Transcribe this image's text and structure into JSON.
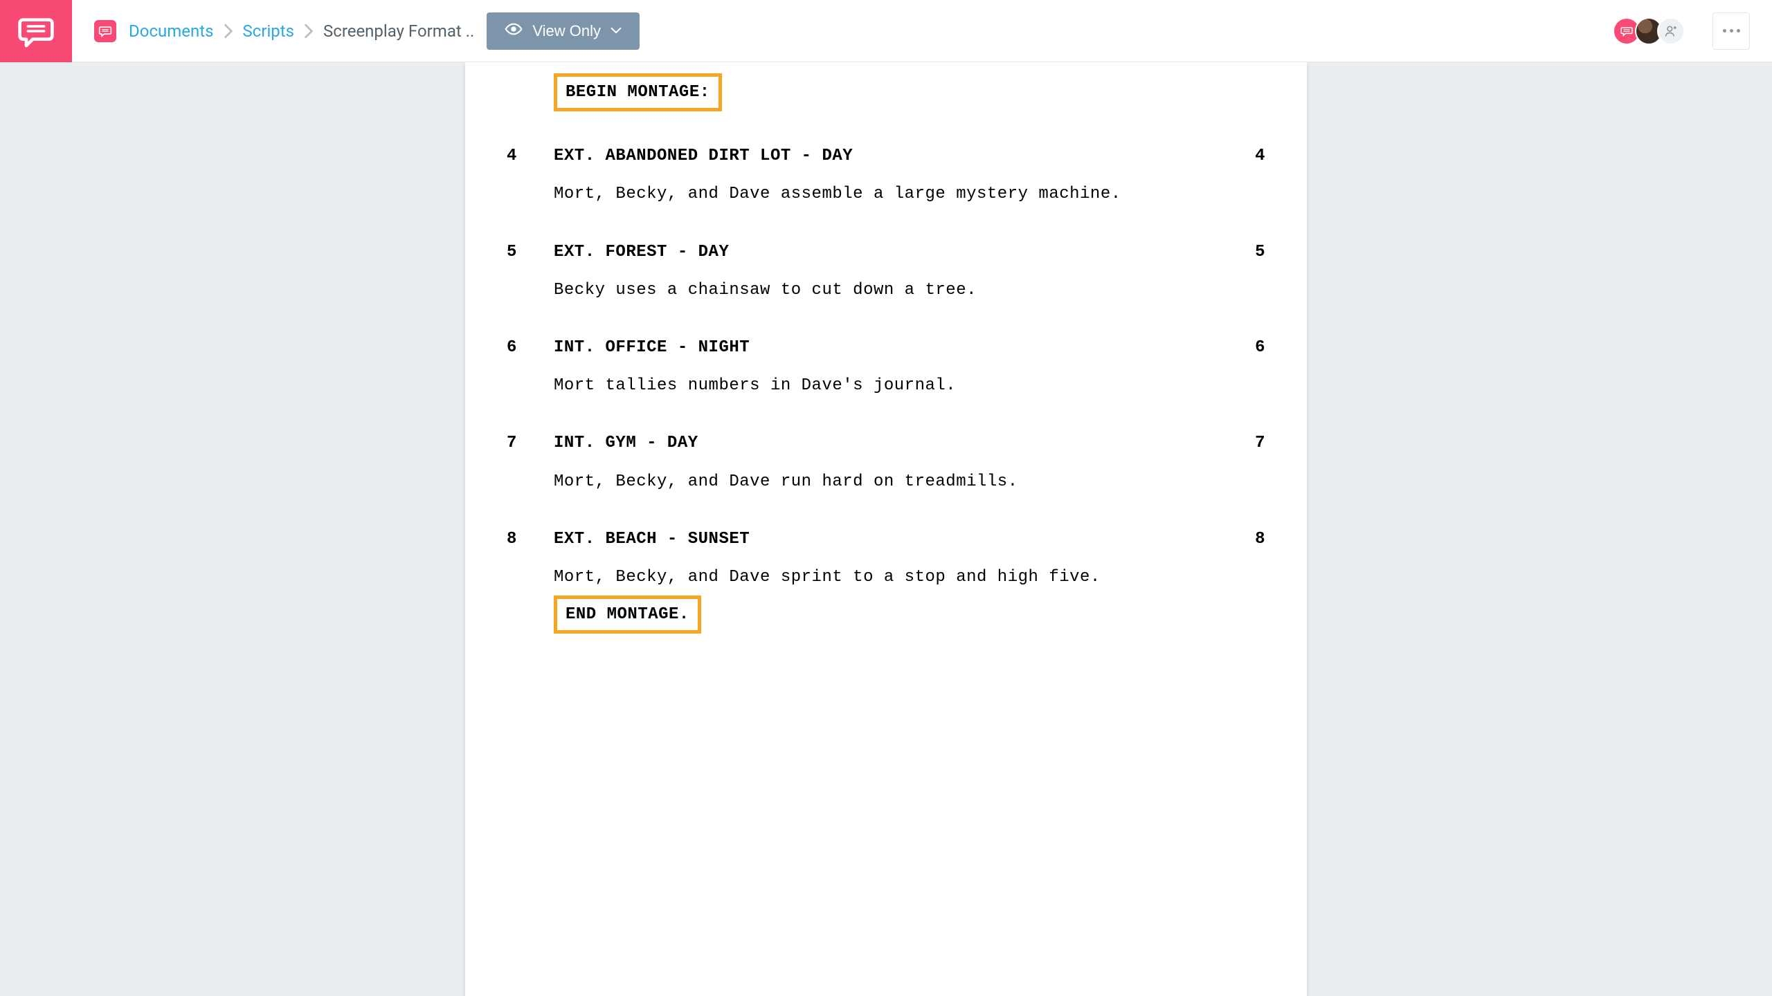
{
  "breadcrumb": {
    "items": [
      "Documents",
      "Scripts"
    ],
    "current": "Screenplay Format .."
  },
  "toolbar": {
    "view_label": "View Only"
  },
  "document": {
    "begin_label": "BEGIN MONTAGE:",
    "end_label": "END MONTAGE.",
    "scenes": [
      {
        "n": "4",
        "heading": "EXT. ABANDONED DIRT LOT - DAY",
        "action": "Mort, Becky, and Dave assemble a large mystery machine."
      },
      {
        "n": "5",
        "heading": "EXT. FOREST - DAY",
        "action": "Becky uses a chainsaw to cut down a tree."
      },
      {
        "n": "6",
        "heading": "INT. OFFICE - NIGHT",
        "action": "Mort tallies numbers in Dave's journal."
      },
      {
        "n": "7",
        "heading": "INT. GYM - DAY",
        "action": "Mort, Becky, and Dave run hard on treadmills."
      },
      {
        "n": "8",
        "heading": "EXT. BEACH - SUNSET",
        "action": "Mort, Becky, and Dave sprint to a stop and high five."
      }
    ]
  }
}
